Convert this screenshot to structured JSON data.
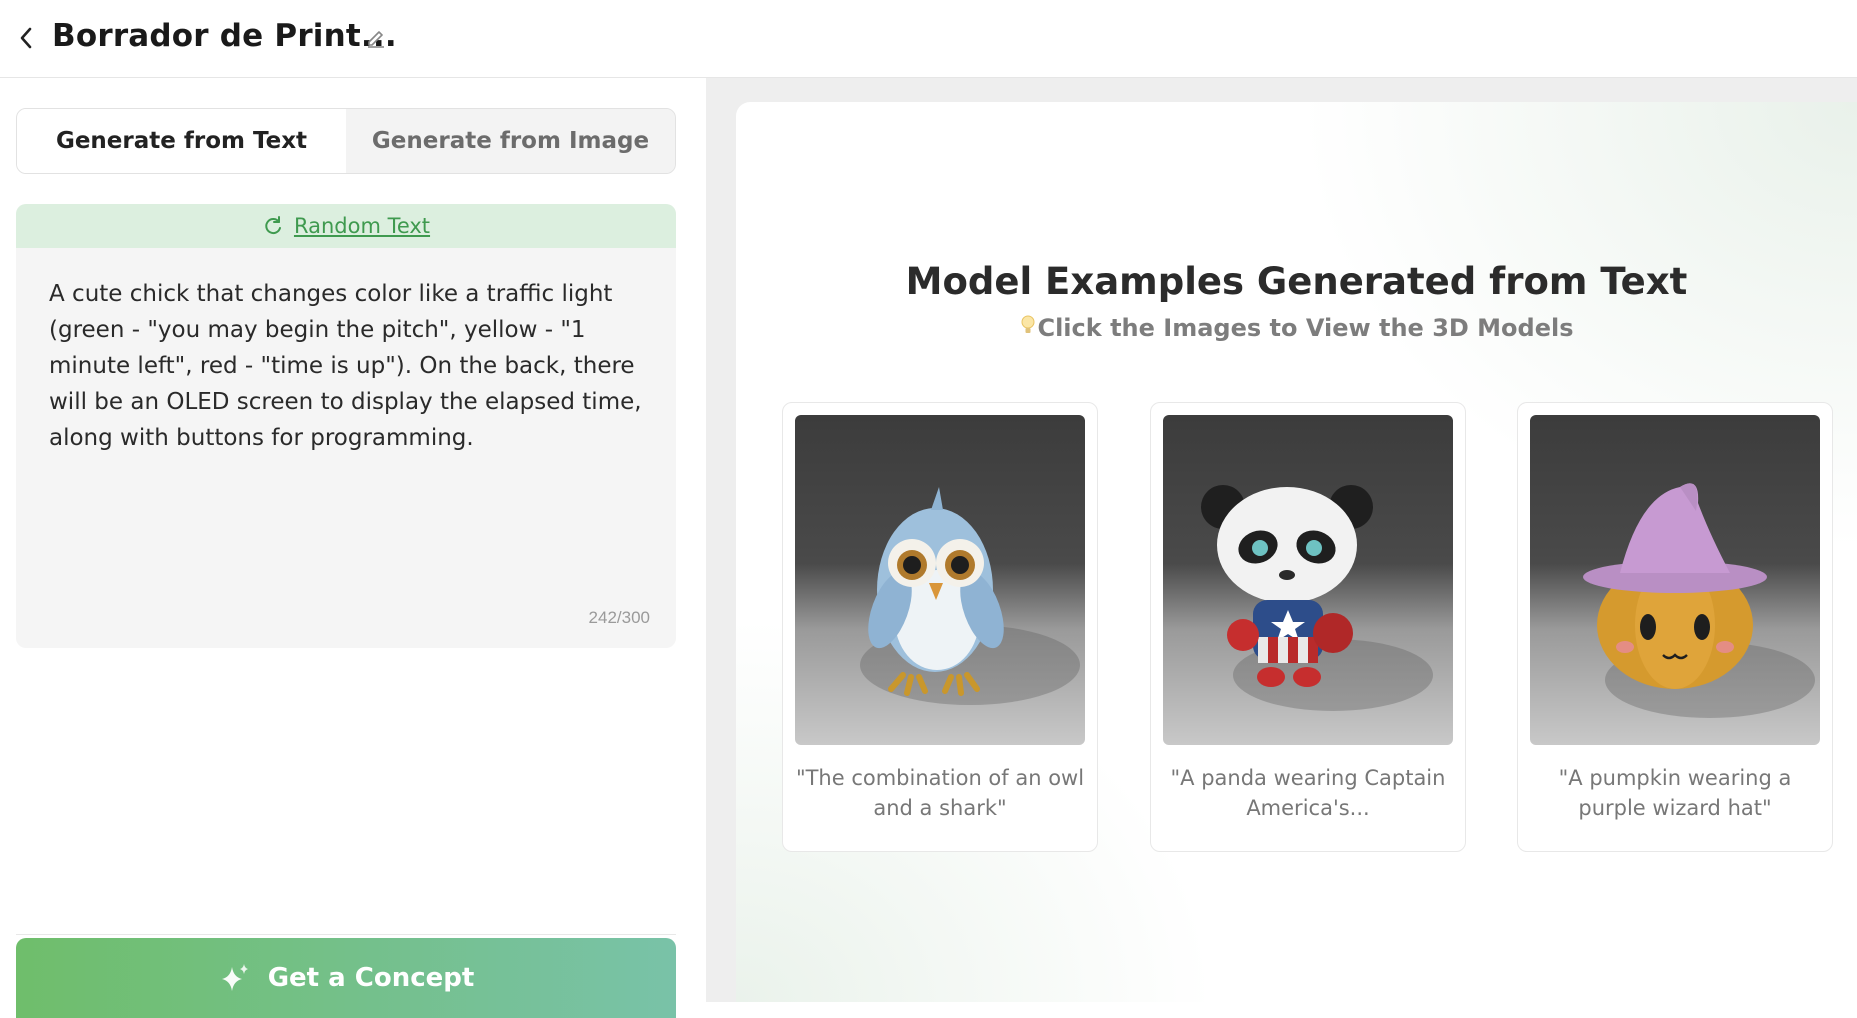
{
  "header": {
    "title": "Borrador de Print...",
    "back_icon": "chevron-left-icon",
    "edit_icon": "pencil-icon"
  },
  "tabs": [
    {
      "label": "Generate from Text",
      "active": true
    },
    {
      "label": "Generate from Image",
      "active": false
    }
  ],
  "prompt": {
    "random_label": "Random Text",
    "random_icon": "refresh-icon",
    "text": "A cute chick that changes color like a traffic light (green - \"you may begin the pitch\", yellow - \"1 minute left\", red - \"time is up\"). On the back, there will be an OLED screen to display the elapsed time, along with buttons for programming.",
    "char_count": "242/300"
  },
  "action": {
    "concept_label": "Get a Concept",
    "concept_icon": "sparkle-icon"
  },
  "examples": {
    "heading": "Model Examples Generated from Text",
    "subheading": "Click the Images to View the 3D Models",
    "hint_icon": "lightbulb-icon",
    "cards": [
      {
        "caption": "\"The combination of an owl and a shark\"",
        "image": "owl-figure"
      },
      {
        "caption": "\"A panda wearing Captain America's...",
        "image": "panda-figure"
      },
      {
        "caption": "\"A pumpkin wearing a purple wizard hat\"",
        "image": "pumpkin-figure"
      }
    ]
  },
  "colors": {
    "accent_green": "#3f9a4f",
    "random_bar_bg": "#dcefdf",
    "button_gradient_start": "#6fbe6b",
    "button_gradient_end": "#79c2a8"
  }
}
